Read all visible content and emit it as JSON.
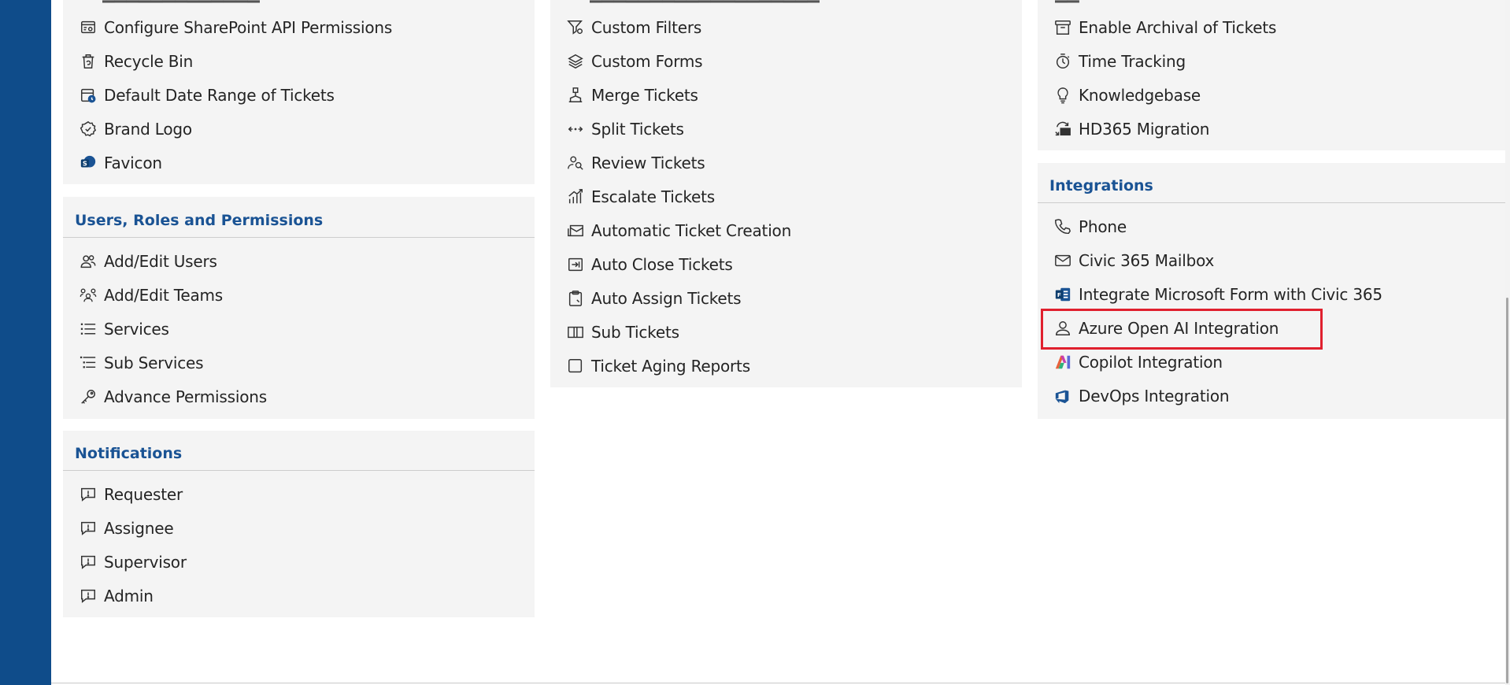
{
  "colors": {
    "rail": "#0f4c8a",
    "heading": "#1a5394",
    "card_bg": "#f4f4f4",
    "highlight": "#e0202e"
  },
  "left_column": {
    "top_items": [
      {
        "label": "Configure SharePoint API Permissions",
        "icon": "sharepoint-config-icon"
      },
      {
        "label": "Recycle Bin",
        "icon": "recycle-bin-icon"
      },
      {
        "label": "Default Date Range of Tickets",
        "icon": "calendar-clock-icon"
      },
      {
        "label": "Brand Logo",
        "icon": "badge-icon"
      },
      {
        "label": "Favicon",
        "icon": "favicon-icon"
      }
    ],
    "users_section": {
      "title": "Users, Roles and Permissions",
      "items": [
        {
          "label": "Add/Edit Users",
          "icon": "users-icon"
        },
        {
          "label": "Add/Edit Teams",
          "icon": "teams-icon"
        },
        {
          "label": "Services",
          "icon": "list-icon"
        },
        {
          "label": "Sub Services",
          "icon": "sub-list-icon"
        },
        {
          "label": "Advance Permissions",
          "icon": "key-icon"
        }
      ]
    },
    "notifications_section": {
      "title": "Notifications",
      "items": [
        {
          "label": "Requester",
          "icon": "alert-comment-icon"
        },
        {
          "label": "Assignee",
          "icon": "alert-comment-icon"
        },
        {
          "label": "Supervisor",
          "icon": "alert-comment-icon"
        },
        {
          "label": "Admin",
          "icon": "alert-comment-icon"
        }
      ]
    }
  },
  "middle_column": {
    "items": [
      {
        "label": "Custom Filters",
        "icon": "filter-settings-icon"
      },
      {
        "label": "Custom Forms",
        "icon": "layers-icon"
      },
      {
        "label": "Merge Tickets",
        "icon": "merge-icon"
      },
      {
        "label": "Split Tickets",
        "icon": "split-arrows-icon"
      },
      {
        "label": "Review Tickets",
        "icon": "review-people-icon"
      },
      {
        "label": "Escalate Tickets",
        "icon": "escalate-chart-icon"
      },
      {
        "label": "Automatic Ticket Creation",
        "icon": "auto-mail-icon"
      },
      {
        "label": "Auto Close Tickets",
        "icon": "auto-close-icon"
      },
      {
        "label": "Auto Assign Tickets",
        "icon": "clipboard-icon"
      },
      {
        "label": "Sub Tickets",
        "icon": "split-panel-icon"
      },
      {
        "label": "Ticket Aging Reports",
        "icon": "square-icon"
      }
    ]
  },
  "right_column": {
    "top_items": [
      {
        "label": "Enable Archival of Tickets",
        "icon": "archive-icon"
      },
      {
        "label": "Time Tracking",
        "icon": "stopwatch-icon"
      },
      {
        "label": "Knowledgebase",
        "icon": "lightbulb-icon"
      },
      {
        "label": "HD365 Migration",
        "icon": "migration-icon"
      }
    ],
    "integrations_section": {
      "title": "Integrations",
      "items": [
        {
          "label": "Phone",
          "icon": "phone-icon"
        },
        {
          "label": "Civic 365 Mailbox",
          "icon": "mail-icon"
        },
        {
          "label": "Integrate Microsoft Form with Civic 365",
          "icon": "ms-forms-icon"
        },
        {
          "label": "Azure Open AI Integration",
          "icon": "person-ai-icon"
        },
        {
          "label": "Copilot Integration",
          "icon": "copilot-icon"
        },
        {
          "label": "DevOps Integration",
          "icon": "devops-icon"
        }
      ]
    }
  }
}
